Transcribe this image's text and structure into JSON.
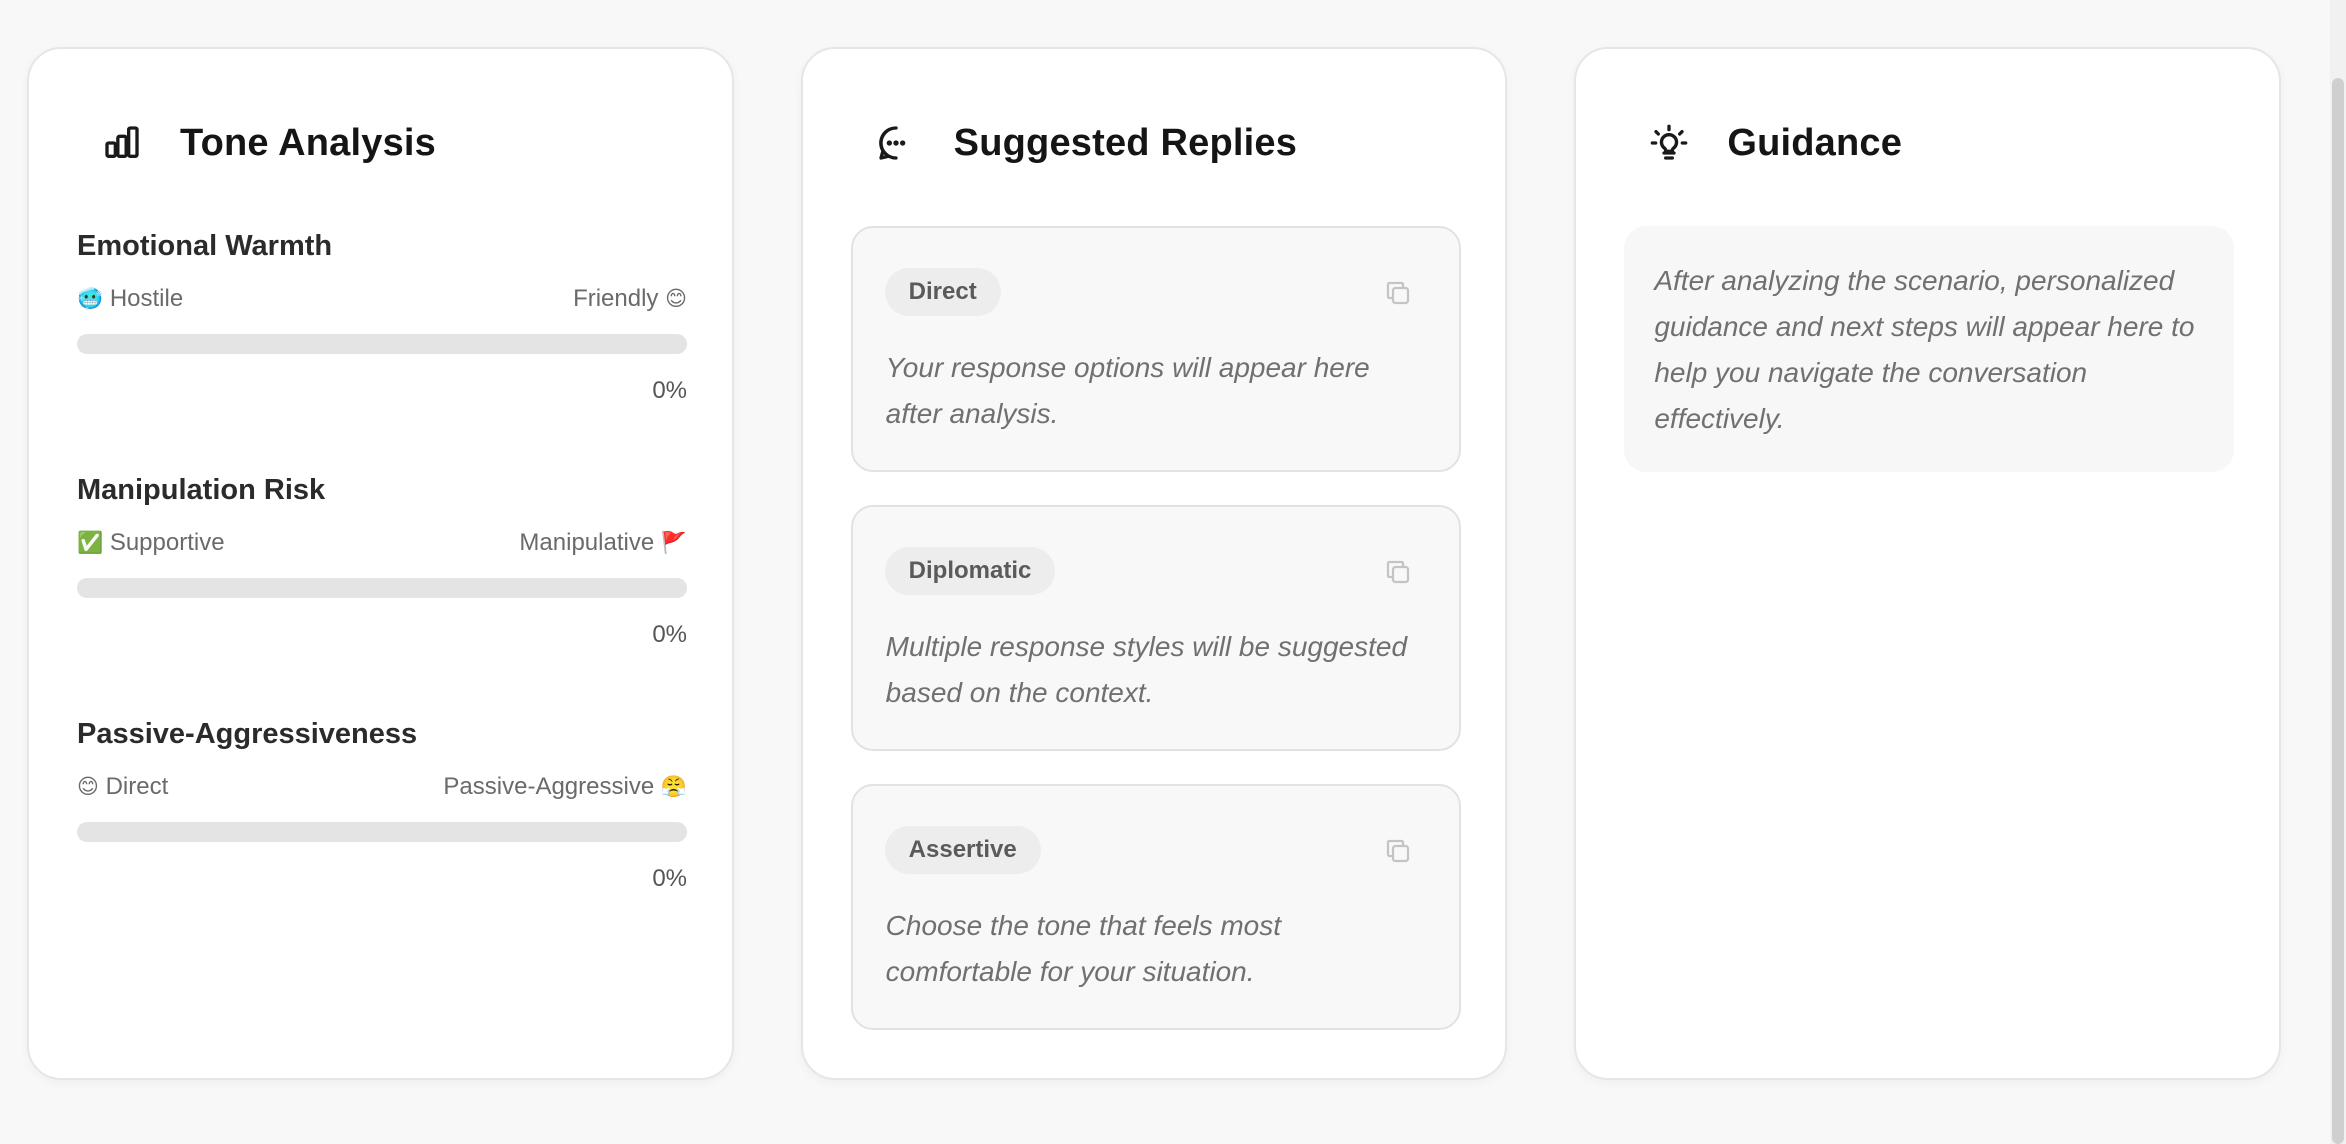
{
  "tone_analysis": {
    "title": "Tone Analysis",
    "icon": "bar-chart-icon",
    "metrics": [
      {
        "title": "Emotional Warmth",
        "left_emoji": "🥶",
        "left_label": "Hostile",
        "right_label": "Friendly",
        "right_emoji": "😊",
        "value": 0,
        "value_text": "0%"
      },
      {
        "title": "Manipulation Risk",
        "left_emoji": "✅",
        "left_label": "Supportive",
        "right_label": "Manipulative",
        "right_emoji": "🚩",
        "value": 0,
        "value_text": "0%"
      },
      {
        "title": "Passive-Aggressiveness",
        "left_emoji": "😊",
        "left_label": "Direct",
        "right_label": "Passive-Aggressive",
        "right_emoji": "😤",
        "value": 0,
        "value_text": "0%"
      }
    ]
  },
  "suggested_replies": {
    "title": "Suggested Replies",
    "icon": "chat-bubble-icon",
    "replies": [
      {
        "tag": "Direct",
        "text": "Your response options will appear here after analysis."
      },
      {
        "tag": "Diplomatic",
        "text": "Multiple response styles will be suggested based on the context."
      },
      {
        "tag": "Assertive",
        "text": "Choose the tone that feels most comfortable for your situation."
      }
    ]
  },
  "guidance": {
    "title": "Guidance",
    "icon": "lightbulb-icon",
    "text": "After analyzing the scenario, personalized guidance and next steps will appear here to help you navigate the conversation effectively."
  },
  "colors": {
    "page_background": "#f8f8f8",
    "card_background": "#ffffff",
    "track": "#e4e4e4",
    "muted_text": "#707070"
  }
}
